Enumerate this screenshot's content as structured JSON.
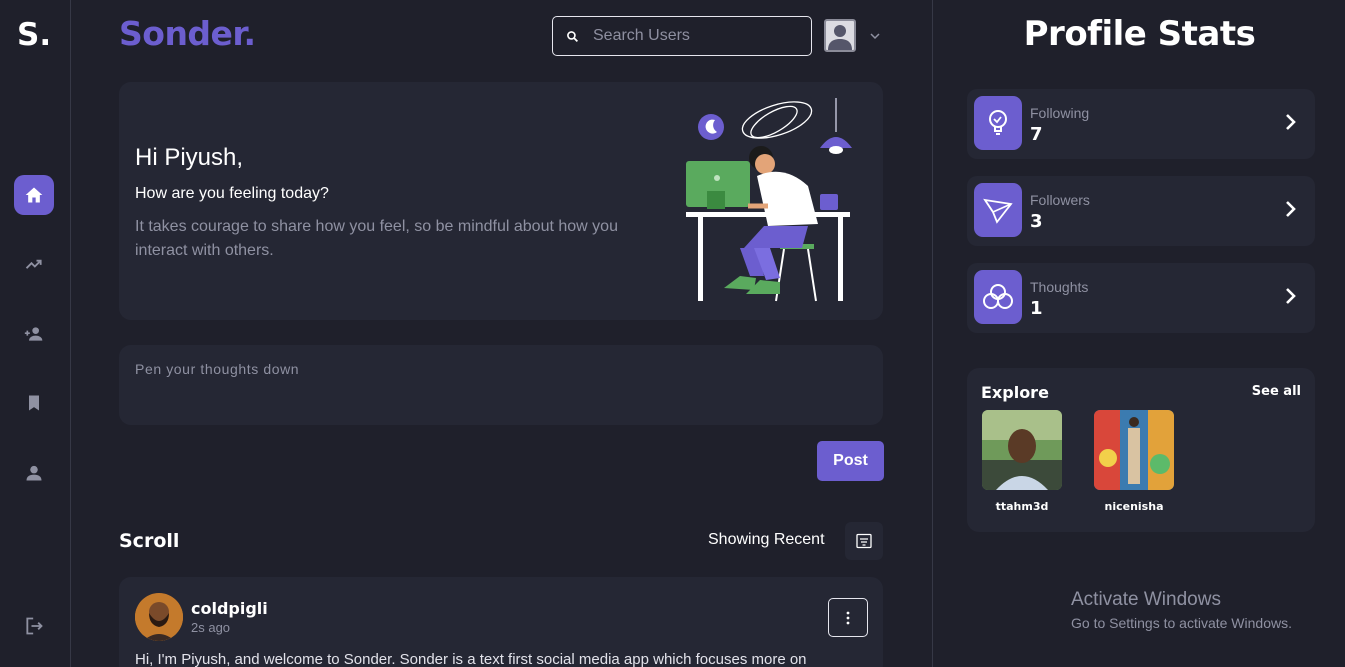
{
  "rail": {
    "logo": "S.",
    "items": [
      "home-icon",
      "trending-icon",
      "add-friend-icon",
      "bookmark-icon",
      "profile-icon"
    ],
    "logout_icon": "logout-icon",
    "accent": "#6c5ecf"
  },
  "header": {
    "brand": "Sonder.",
    "search_placeholder": "Search Users"
  },
  "hero": {
    "greeting": "Hi Piyush,",
    "question": "How are you feeling today?",
    "message": "It takes courage to share how you feel, so be mindful about how you interact with others."
  },
  "composer": {
    "placeholder": "Pen your thoughts down",
    "post_label": "Post"
  },
  "feed": {
    "title": "Scroll",
    "sort_label": "Showing Recent",
    "posts": [
      {
        "user": "coldpigli",
        "time": "2s ago",
        "text": "Hi, I'm Piyush, and welcome to Sonder. Sonder is a text first social media app which focuses more on"
      }
    ]
  },
  "profile_stats": {
    "title": "Profile Stats",
    "stats": [
      {
        "label": "Following",
        "value": "7",
        "icon": "bulb-icon"
      },
      {
        "label": "Followers",
        "value": "3",
        "icon": "paper-plane-icon"
      },
      {
        "label": "Thoughts",
        "value": "1",
        "icon": "cloud-icon"
      }
    ]
  },
  "explore": {
    "title": "Explore",
    "see_all": "See all",
    "users": [
      {
        "name": "ttahm3d"
      },
      {
        "name": "nicenisha"
      }
    ]
  },
  "watermark": {
    "line1": "Activate Windows",
    "line2": "Go to Settings to activate Windows."
  }
}
